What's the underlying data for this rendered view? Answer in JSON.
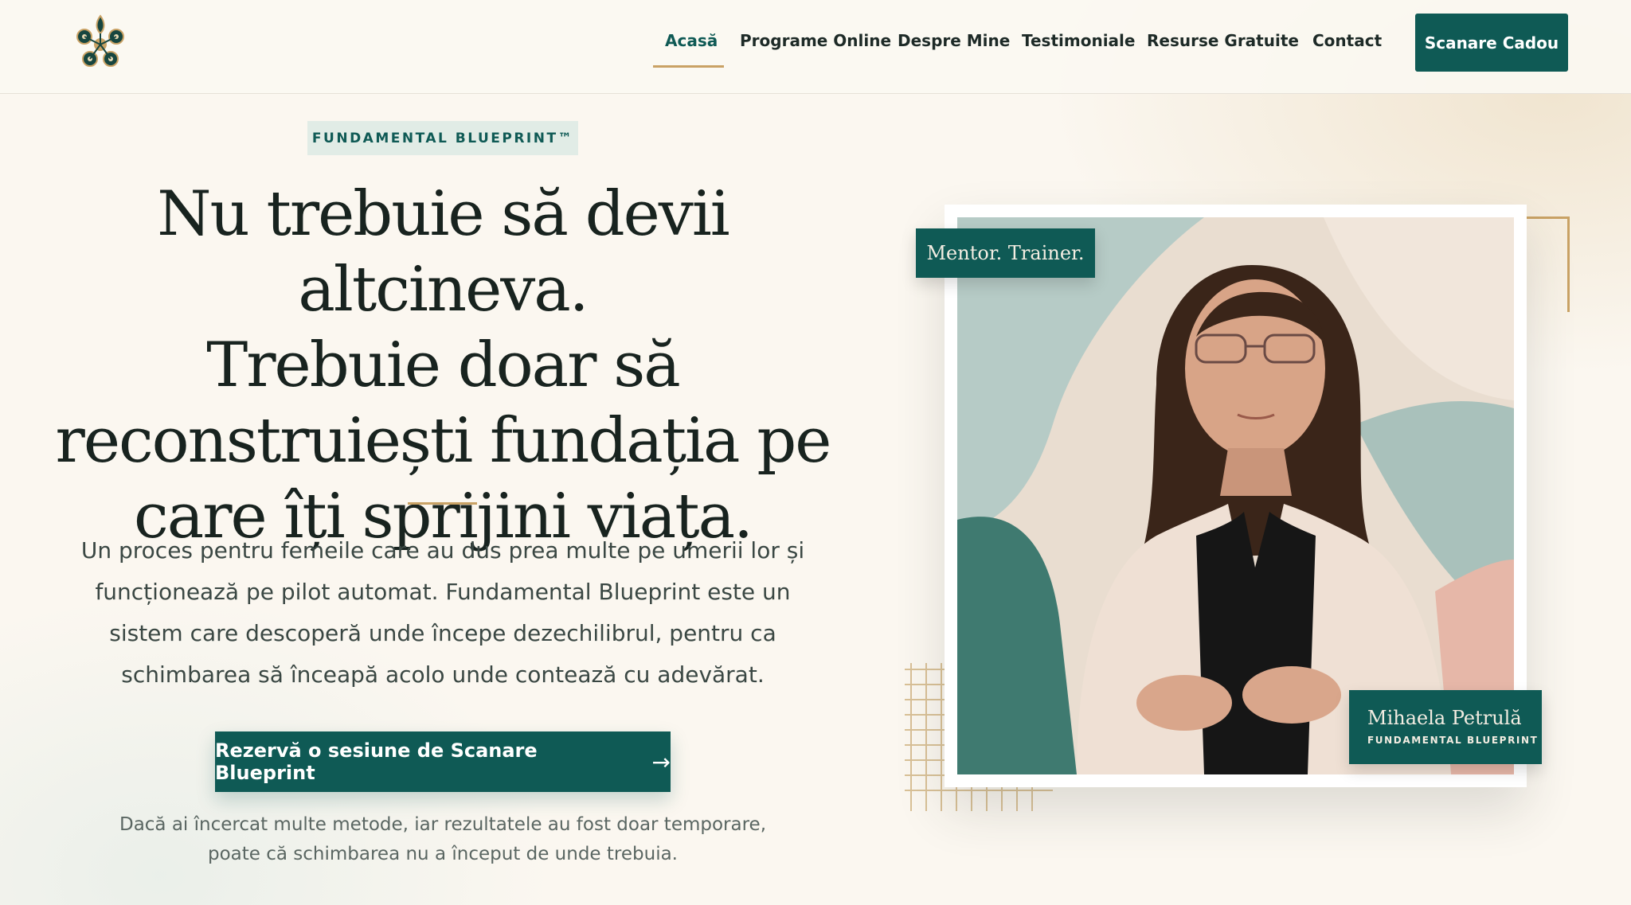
{
  "header": {
    "nav": [
      {
        "label": "Acasă",
        "active": true
      },
      {
        "label": "Programe Online"
      },
      {
        "label": "Despre Mine"
      },
      {
        "label": "Testimoniale"
      },
      {
        "label": "Resurse Gratuite"
      },
      {
        "label": "Contact"
      }
    ],
    "cta_label": "Scanare Cadou"
  },
  "hero": {
    "badge": "FUNDAMENTAL BLUEPRINT™",
    "headline_lines": [
      "Nu trebuie să devii altcineva.",
      "Trebuie doar să",
      "reconstruiești fundația pe",
      "care îți sprijini viața."
    ],
    "lead": "Un proces pentru femeile care au dus prea multe pe umerii lor și funcționează pe pilot automat. Fundamental Blueprint este un sistem care descoperă unde începe dezechilibrul, pentru ca schimbarea să înceapă acolo unde contează cu adevărat.",
    "cta_label": "Rezervă o sesiune de Scanare Blueprint",
    "note": "Dacă ai încercat multe metode, iar rezultatele au fost doar temporare, poate că schimbarea nu a început de unde trebuia."
  },
  "portrait": {
    "tag": "Mentor. Trainer.",
    "name": "Mihaela Petrulă",
    "subtitle": "FUNDAMENTAL BLUEPRINT"
  },
  "colors": {
    "brand": "#0f5a55",
    "accent": "#c9a265",
    "background": "#fbf7f0"
  }
}
